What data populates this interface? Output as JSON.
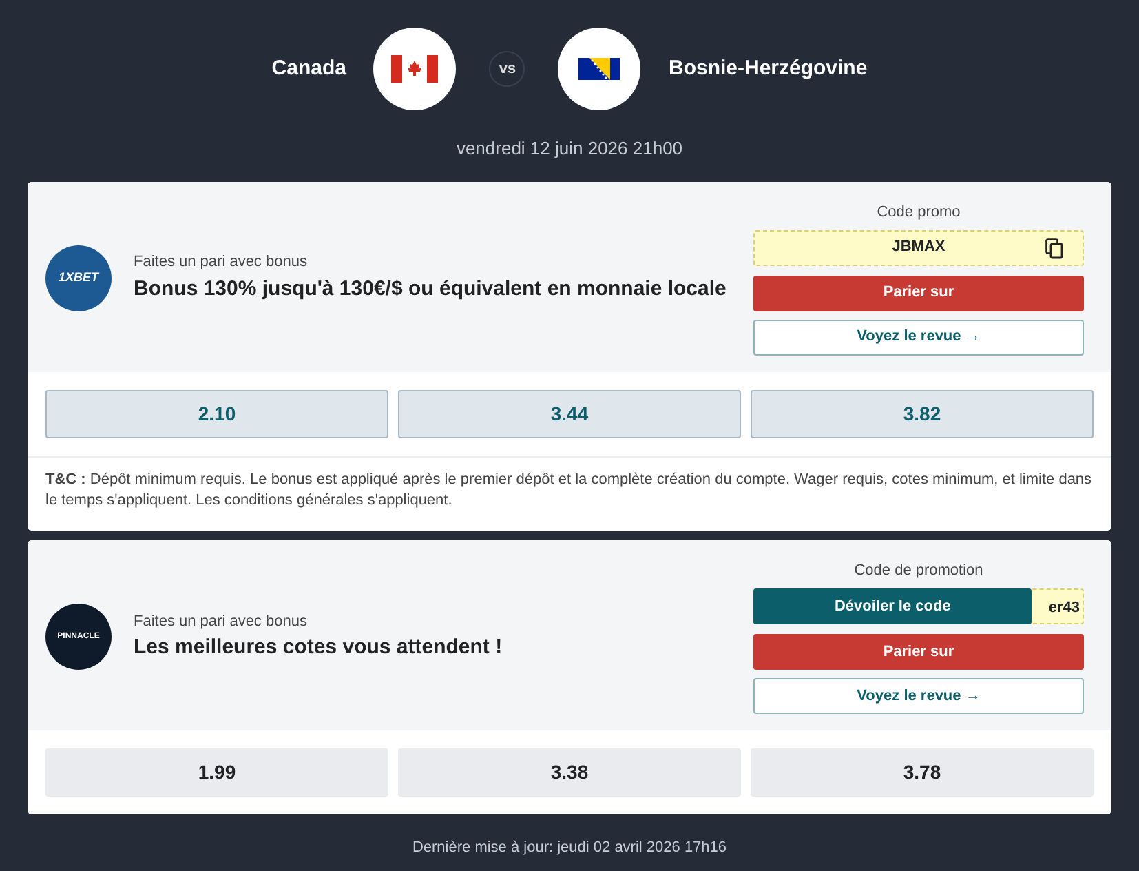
{
  "match": {
    "home": "Canada",
    "away": "Bosnie-Herzégovine",
    "vs": "vs",
    "date": "vendredi 12 juin 2026 21h00"
  },
  "offers": [
    {
      "logo_text": "1XBET",
      "color": "#1d5a94",
      "tagline": "Faites un pari avec bonus",
      "title": "Bonus 130% jusqu'à 130€/$ ou équivalent en monnaie locale",
      "code_label": "Code promo",
      "code": {
        "kind": "shown",
        "text": "JBMAX"
      },
      "bet": "Parier sur",
      "review": "Voyez le revue",
      "review_arrow": "→",
      "odds_highlighted": true,
      "odds": [
        "2.10",
        "3.44",
        "3.82"
      ],
      "terms": "**T&C :** Dépôt minimum requis. Le bonus est appliqué après le premier dépôt et la complète création du compte. Wager requis, cotes minimum, et limite dans le temps s'appliquent. Les conditions générales s'appliquent."
    },
    {
      "logo_text": "PINNACLE",
      "color": "#0f1a2b",
      "tagline": "Faites un pari avec bonus",
      "title": "Les meilleures cotes vous attendent !",
      "code_label": "Code de promotion",
      "code": {
        "kind": "hidden",
        "text": "Dévoiler le code",
        "peek": "er43"
      },
      "bet": "Parier sur",
      "review": "Voyez le revue",
      "review_arrow": "→",
      "odds_highlighted": false,
      "odds": [
        "1.99",
        "3.38",
        "3.78"
      ]
    }
  ],
  "footer": "Dernière mise à jour: jeudi 02 avril 2026 17h16"
}
